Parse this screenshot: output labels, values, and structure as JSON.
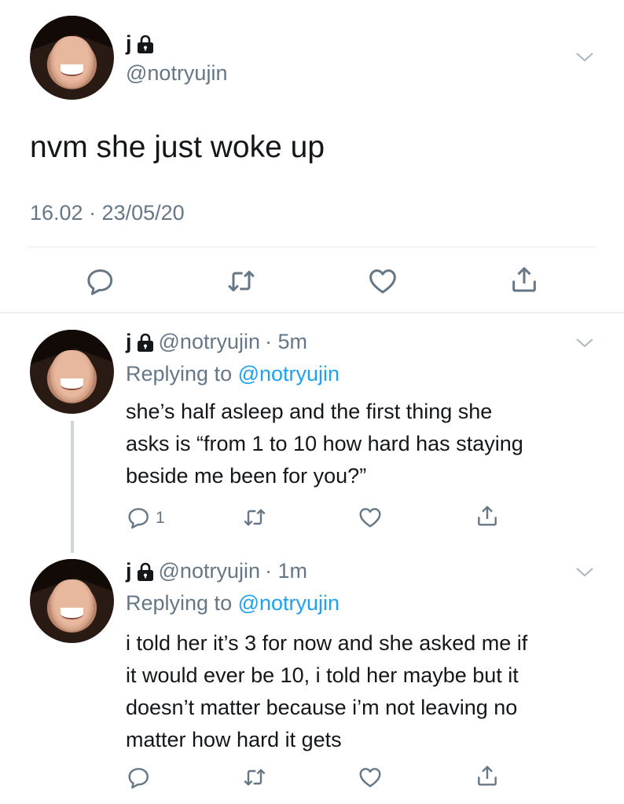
{
  "main_tweet": {
    "name": "j",
    "handle": "@notryujin",
    "text": "nvm she just woke up",
    "timestamp": "16.02 · 23/05/20"
  },
  "replies": [
    {
      "name": "j",
      "handle": "@notryujin",
      "time": "· 5m",
      "replying_label": "Replying to",
      "replying_handle": "@notryujin",
      "lines": [
        "she’s half asleep and the first thing she",
        "asks is “from 1 to 10 how hard has staying",
        "beside me been for you?”"
      ],
      "reply_count": "1"
    },
    {
      "name": "j",
      "handle": "@notryujin",
      "time": "· 1m",
      "replying_label": "Replying to",
      "replying_handle": "@notryujin",
      "lines": [
        "i told her it’s 3 for now and she asked me if",
        "it would ever be 10, i told her maybe but it",
        "doesn’t matter because i’m not leaving no",
        "matter how hard it gets"
      ],
      "reply_count": ""
    }
  ],
  "icons": {
    "reply": "reply-icon",
    "retweet": "retweet-icon",
    "like": "heart-icon",
    "share": "share-icon",
    "menu": "chevron-down-icon",
    "lock": "lock-icon"
  },
  "colors": {
    "text": "#14171a",
    "secondary": "#657786",
    "link": "#1da1f2",
    "divider": "#e1e8ed",
    "thread_line": "#ccd6dd"
  }
}
